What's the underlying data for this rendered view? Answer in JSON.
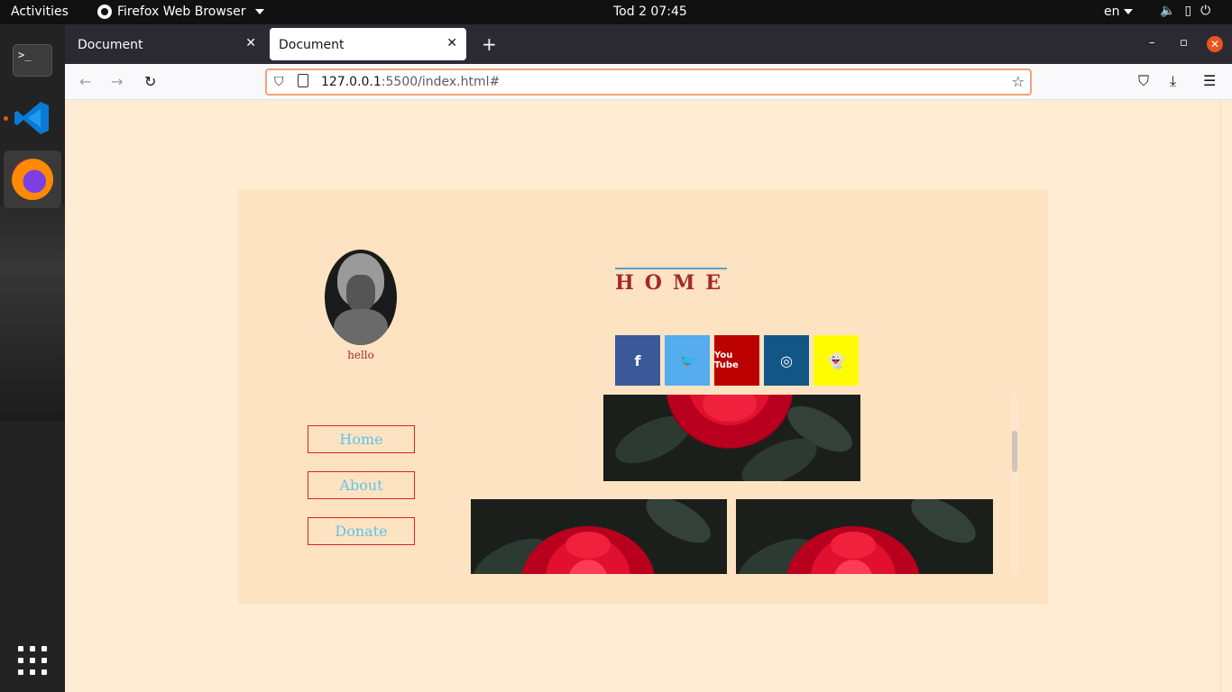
{
  "topbar": {
    "activities": "Activities",
    "app_name": "Firefox Web Browser",
    "clock": "Tod 2  07:45",
    "lang": "en"
  },
  "dock": {
    "items": [
      "terminal-icon",
      "vscode-icon",
      "firefox-icon",
      "show-apps-icon"
    ]
  },
  "browser": {
    "tabs": [
      {
        "label": "Document",
        "active": false
      },
      {
        "label": "Document",
        "active": true
      }
    ],
    "url_host": "127.0.0.1",
    "url_path": ":5500/index.html#"
  },
  "page": {
    "profile_caption": "hello",
    "nav_links": [
      "Home",
      "About",
      "Donate"
    ],
    "heading": "HOME",
    "social": [
      {
        "name": "facebook",
        "glyph": "f",
        "color": "#3b5998"
      },
      {
        "name": "twitter",
        "glyph": "🐦",
        "color": "#55acee"
      },
      {
        "name": "youtube",
        "glyph": "You Tube",
        "color": "#bb0000"
      },
      {
        "name": "instagram",
        "glyph": "◎",
        "color": "#125688"
      },
      {
        "name": "snapchat",
        "glyph": "👻",
        "color": "#fffc00"
      }
    ]
  },
  "colors": {
    "page_bg": "#ffecd2",
    "card_bg": "#fee3c2",
    "accent_red": "#a52a2a",
    "link_blue": "#5fc4e8",
    "border_red": "#e02020"
  }
}
